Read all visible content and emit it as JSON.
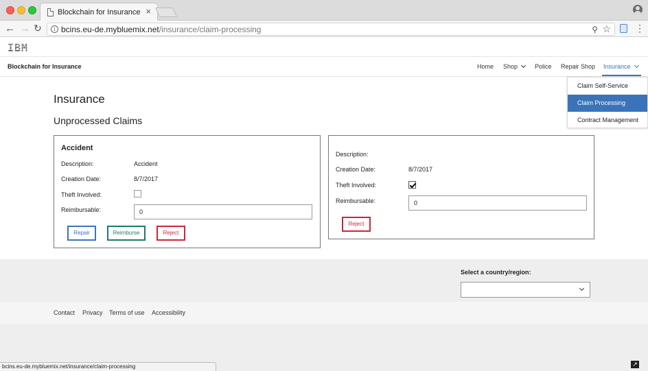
{
  "browser": {
    "tab_title": "Blockchain for Insurance",
    "tab_close": "×",
    "url_host": "bcins.eu-de.mybluemix.net",
    "url_path": "/insurance/claim-processing",
    "info_glyph": "i",
    "back_glyph": "←",
    "forward_glyph": "→",
    "reload_glyph": "↻",
    "zoom_glyph": "⚲",
    "star_glyph": "☆",
    "menu_glyph": "⋮",
    "status_url": "bcins.eu-de.mybluemix.net/insurance/claim-processing"
  },
  "header": {
    "logo": "IBM",
    "site_title": "Blockchain for Insurance"
  },
  "nav": {
    "home": "Home",
    "shop": "Shop",
    "police": "Police",
    "repair_shop": "Repair Shop",
    "insurance": "Insurance",
    "dropdown": [
      {
        "label": "Claim Self-Service",
        "active": false
      },
      {
        "label": "Claim Processing",
        "active": true
      },
      {
        "label": "Contract Management",
        "active": false
      }
    ]
  },
  "main": {
    "heading": "Insurance",
    "subheading": "Unprocessed Claims",
    "claims": [
      {
        "title": "Accident",
        "description_label": "Description:",
        "description": "Accident",
        "creation_date_label": "Creation Date:",
        "creation_date": "8/7/2017",
        "theft_label": "Theft Involved:",
        "theft_involved": false,
        "reimbursable_label": "Reimbursable:",
        "reimbursable": "0",
        "buttons": {
          "repair": "Repair",
          "reimburse": "Reimburse",
          "reject": "Reject"
        }
      },
      {
        "title": "",
        "description_label": "Description:",
        "description": "",
        "creation_date_label": "Creation Date:",
        "creation_date": "8/7/2017",
        "theft_label": "Theft Involved:",
        "theft_involved": true,
        "reimbursable_label": "Reimbursable:",
        "reimbursable": "0",
        "buttons": {
          "reject": "Reject"
        }
      }
    ]
  },
  "footer": {
    "country_label": "Select a country/region:",
    "country_value": "",
    "links": [
      "Contact",
      "Privacy",
      "Terms of use",
      "Accessibility"
    ]
  },
  "colors": {
    "accent": "#3b73b9",
    "reimburse": "#1f7a63",
    "reject": "#d0243a"
  }
}
